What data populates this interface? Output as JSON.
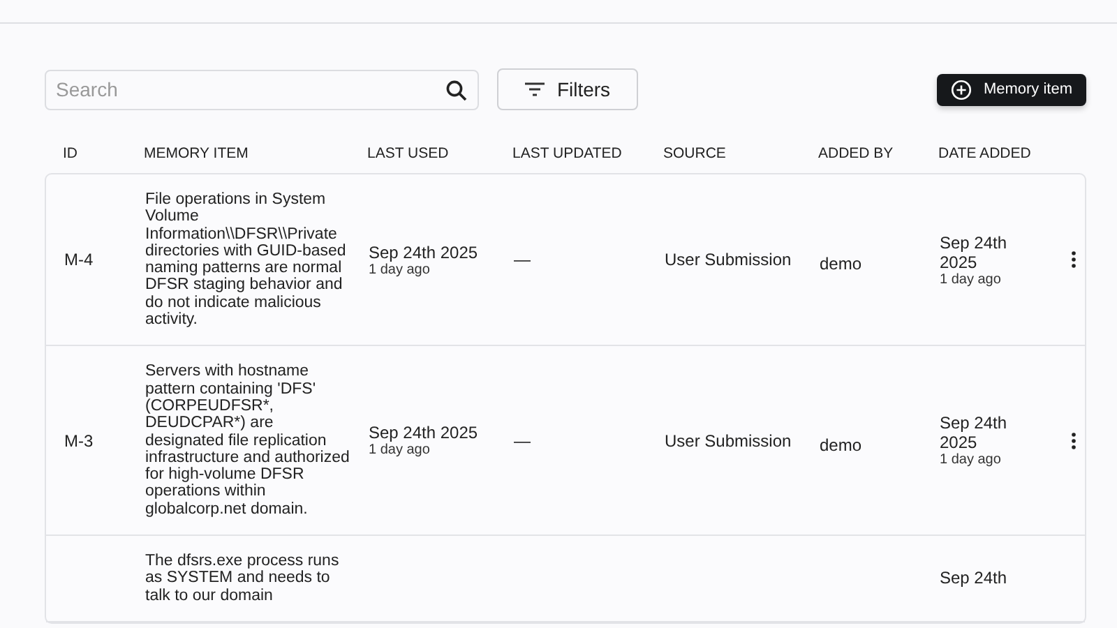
{
  "search": {
    "placeholder": "Search"
  },
  "filters_button": "Filters",
  "add_button": "Memory item",
  "table": {
    "columns": [
      "ID",
      "MEMORY ITEM",
      "LAST USED",
      "LAST UPDATED",
      "SOURCE",
      "ADDED BY",
      "DATE ADDED"
    ],
    "rows": [
      {
        "id": "M-4",
        "memory_item": "File operations in System Volume Information\\\\DFSR\\\\Private directories with GUID-based naming patterns are normal DFSR staging behavior and do not indicate malicious activity.",
        "last_used": "Sep 24th 2025",
        "last_used_ago": "1 day ago",
        "last_updated": "—",
        "source": "User Submission",
        "added_by": "demo",
        "date_added": "Sep 24th 2025",
        "date_added_ago": "1 day ago"
      },
      {
        "id": "M-3",
        "memory_item": "Servers with hostname pattern containing 'DFS' (CORPEUDFSR*, DEUDCPAR*) are designated file replication infrastructure and authorized for high-volume DFSR operations within globalcorp.net domain.",
        "last_used": "Sep 24th 2025",
        "last_used_ago": "1 day ago",
        "last_updated": "—",
        "source": "User Submission",
        "added_by": "demo",
        "date_added": "Sep 24th 2025",
        "date_added_ago": "1 day ago"
      },
      {
        "memory_item": "The dfsrs.exe process runs as SYSTEM and needs to talk to our domain",
        "date_added": "Sep 24th"
      }
    ]
  }
}
